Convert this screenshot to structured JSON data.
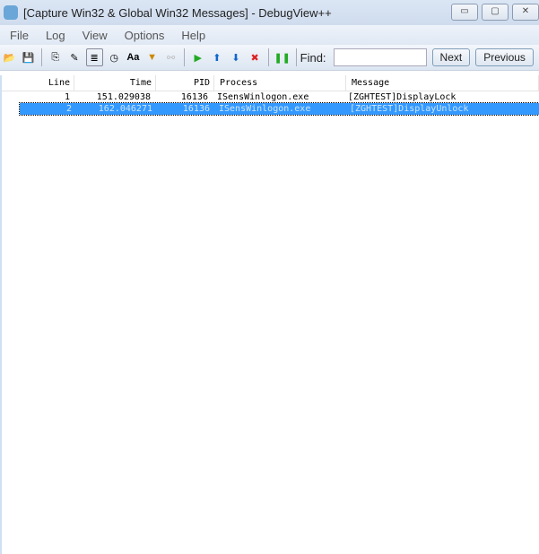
{
  "window": {
    "title": "[Capture Win32 & Global Win32 Messages] - DebugView++"
  },
  "menu": [
    "File",
    "Log",
    "View",
    "Options",
    "Help"
  ],
  "toolbar": {
    "find_label": "Find:",
    "find_value": "",
    "next": "Next",
    "previous": "Previous"
  },
  "table": {
    "headers": [
      "Line",
      "Time",
      "PID",
      "Process",
      "Message"
    ],
    "rows": [
      [
        "1",
        "151.029038",
        "16136",
        "ISensWinlogon.exe",
        "[ZGHTEST]DisplayLock"
      ],
      [
        "2",
        "162.046271",
        "16136",
        "ISensWinlogon.exe",
        "[ZGHTEST]DisplayUnlock"
      ]
    ]
  }
}
